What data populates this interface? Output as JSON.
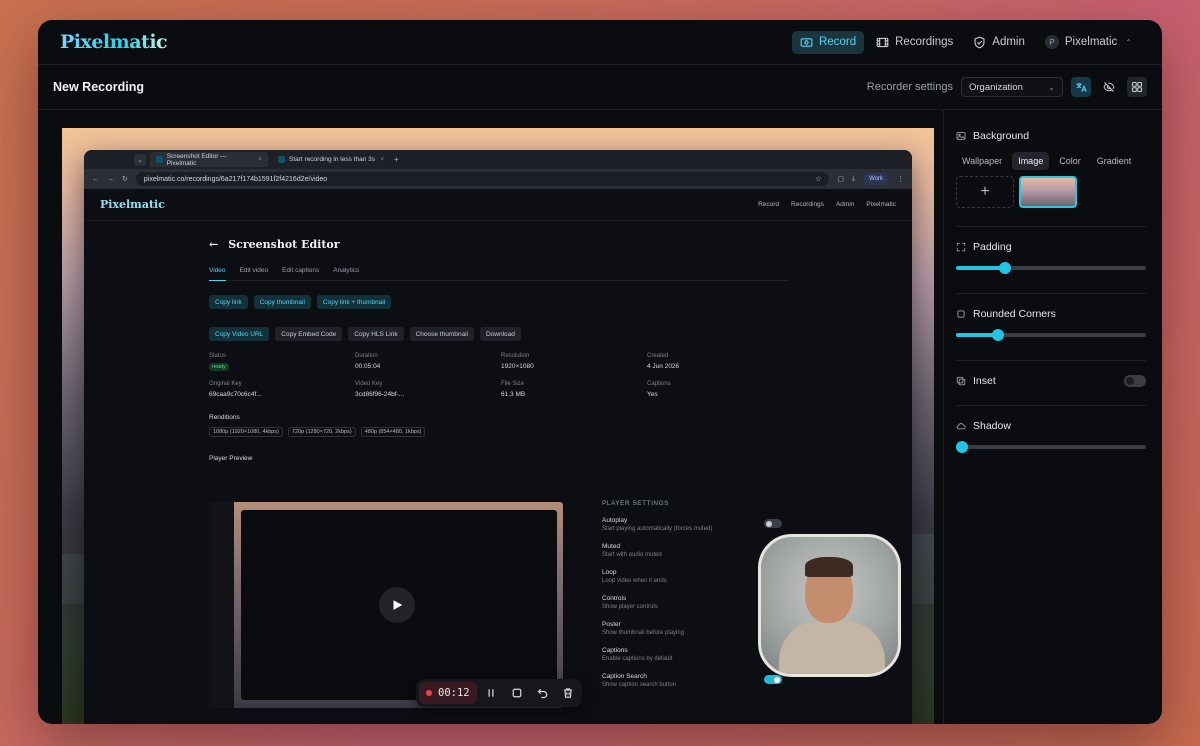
{
  "app": {
    "logo": "Pixelmatic"
  },
  "nav": {
    "record": "Record",
    "recordings": "Recordings",
    "admin": "Admin",
    "user_initial": "P",
    "user_name": "Pixelmatic"
  },
  "subbar": {
    "title": "New Recording",
    "settings_label": "Recorder settings",
    "settings_value": "Organization"
  },
  "browser": {
    "tab1": "Screenshot Editor — Pixelmatic",
    "tab2": "Start recording in less than 3s",
    "url": "pixelmatic.co/recordings/6a217f174b1591f2f4216d2e/video",
    "work": "Work",
    "inner_logo": "Pixelmatic",
    "inner_nav": [
      "Record",
      "Recordings",
      "Admin",
      "Pixelmatic"
    ]
  },
  "editor": {
    "title": "Screenshot Editor",
    "tabs": [
      "Video",
      "Edit video",
      "Edit captions",
      "Analytics"
    ],
    "copy_buttons": [
      "Copy link",
      "Copy thumbnail",
      "Copy link + thumbnail"
    ],
    "actions": [
      "Copy Video URL",
      "Copy Embed Code",
      "Copy HLS Link",
      "Choose thumbnail",
      "Download"
    ],
    "meta": {
      "status_label": "Status",
      "status": "ready",
      "duration_label": "Duration",
      "duration": "00:05:04",
      "resolution_label": "Resolution",
      "resolution": "1920×1080",
      "created_label": "Created",
      "created": "4 Jun 2026",
      "orig_key_label": "Original Key",
      "orig_key": "69caa9c70c6c4f...",
      "video_key_label": "Video Key",
      "video_key": "3cd86f96-24bf-...",
      "size_label": "File Size",
      "size": "61.3 MB",
      "captions_label": "Captions",
      "captions": "Yes"
    },
    "renditions_title": "Renditions",
    "renditions": [
      "1080p (1920×1080, 4kbps)",
      "720p (1280×720, 2kbps)",
      "480p (854×480, 1kbps)"
    ],
    "player_preview": "Player Preview",
    "player_settings": {
      "heading": "PLAYER SETTINGS",
      "items": [
        {
          "t": "Autoplay",
          "d": "Start playing automatically (forces muted)"
        },
        {
          "t": "Muted",
          "d": "Start with audio muted"
        },
        {
          "t": "Loop",
          "d": "Loop video when it ends"
        },
        {
          "t": "Controls",
          "d": "Show player controls"
        },
        {
          "t": "Poster",
          "d": "Show thumbnail before playing"
        },
        {
          "t": "Captions",
          "d": "Enable captions by default"
        },
        {
          "t": "Caption Search",
          "d": "Show caption search button"
        }
      ]
    }
  },
  "recorder": {
    "timer": "00:12"
  },
  "panel": {
    "background": {
      "label": "Background",
      "tabs": [
        "Wallpaper",
        "Image",
        "Color",
        "Gradient"
      ],
      "add": "+"
    },
    "padding": {
      "label": "Padding",
      "value": 0.26
    },
    "corners": {
      "label": "Rounded Corners",
      "value": 0.22
    },
    "inset": {
      "label": "Inset",
      "enabled": false
    },
    "shadow": {
      "label": "Shadow",
      "value": 0.03
    }
  },
  "colors": {
    "accent": "#22c6e4",
    "bg": "#0b0c10"
  }
}
